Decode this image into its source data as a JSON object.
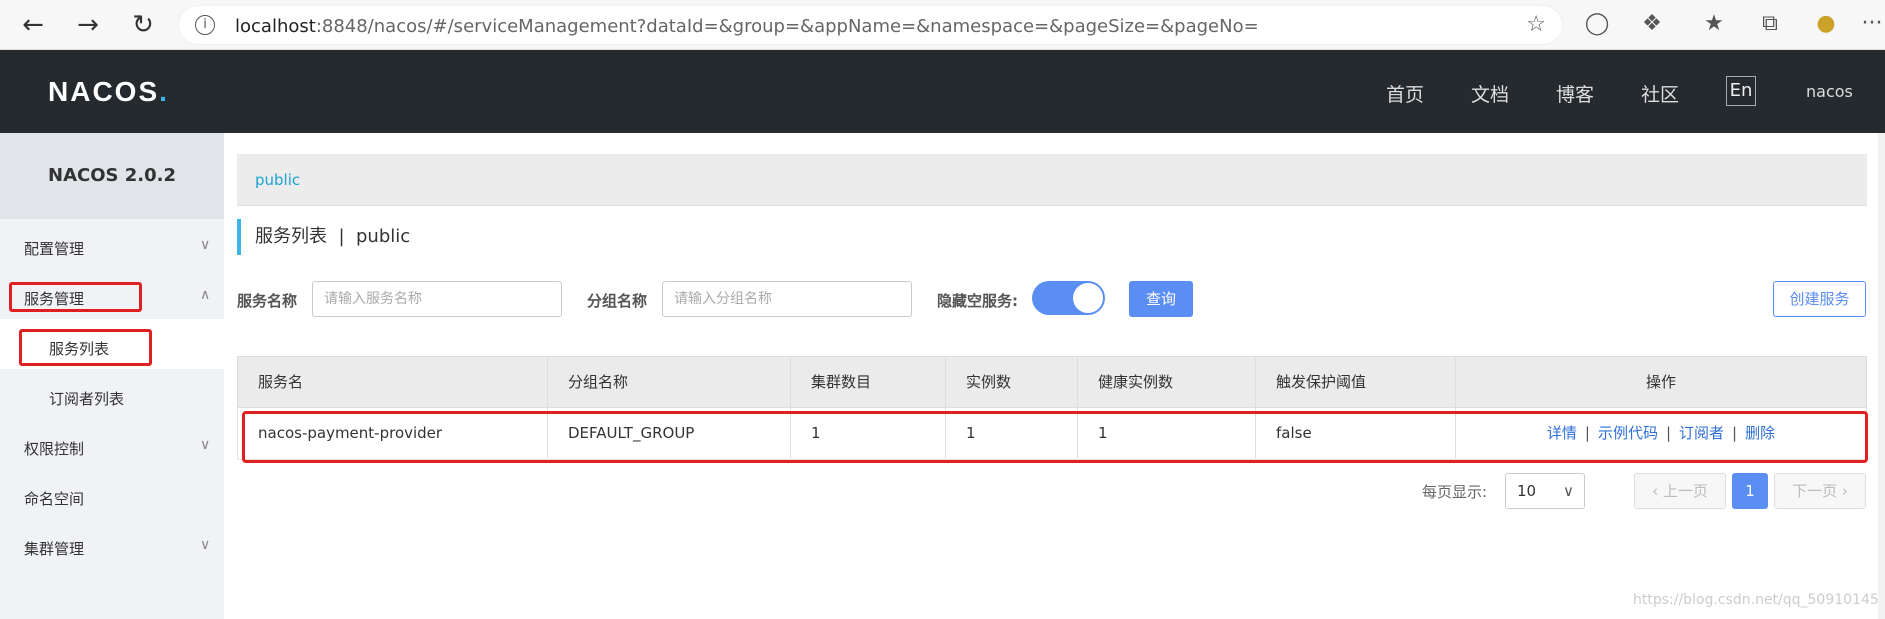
{
  "browser": {
    "url_host": "localhost",
    "url_rest": ":8848/nacos/#/serviceManagement?dataId=&group=&appName=&namespace=&pageSize=&pageNo=",
    "more": "···"
  },
  "header": {
    "logo_main": "NACOS",
    "logo_dot": ".",
    "nav": [
      "首页",
      "文档",
      "博客",
      "社区"
    ],
    "lang": "En",
    "user": "nacos"
  },
  "sidebar": {
    "version": "NACOS 2.0.2",
    "items": [
      {
        "label": "配置管理"
      },
      {
        "label": "服务管理"
      },
      {
        "label": "服务列表"
      },
      {
        "label": "订阅者列表"
      },
      {
        "label": "权限控制"
      },
      {
        "label": "命名空间"
      },
      {
        "label": "集群管理"
      }
    ]
  },
  "main": {
    "namespace_crumb": "public",
    "title": "服务列表",
    "title_sep": "|",
    "title_ns": "public",
    "filters": {
      "service_label": "服务名称",
      "service_placeholder": "请输入服务名称",
      "group_label": "分组名称",
      "group_placeholder": "请输入分组名称",
      "hide_empty_label": "隐藏空服务:",
      "hide_empty_on": true,
      "query_button": "查询",
      "create_button": "创建服务"
    },
    "table": {
      "headers": [
        "服务名",
        "分组名称",
        "集群数目",
        "实例数",
        "健康实例数",
        "触发保护阈值",
        "操作"
      ],
      "rows": [
        {
          "name": "nacos-payment-provider",
          "group": "DEFAULT_GROUP",
          "clusters": "1",
          "instances": "1",
          "healthy": "1",
          "threshold": "false",
          "ops": [
            "详情",
            "示例代码",
            "订阅者",
            "删除"
          ]
        }
      ]
    },
    "pagination": {
      "page_size_label": "每页显示:",
      "page_size": "10",
      "prev": "上一页",
      "current": "1",
      "next": "下一页"
    },
    "watermark": "https://blog.csdn.net/qq_50910145"
  }
}
